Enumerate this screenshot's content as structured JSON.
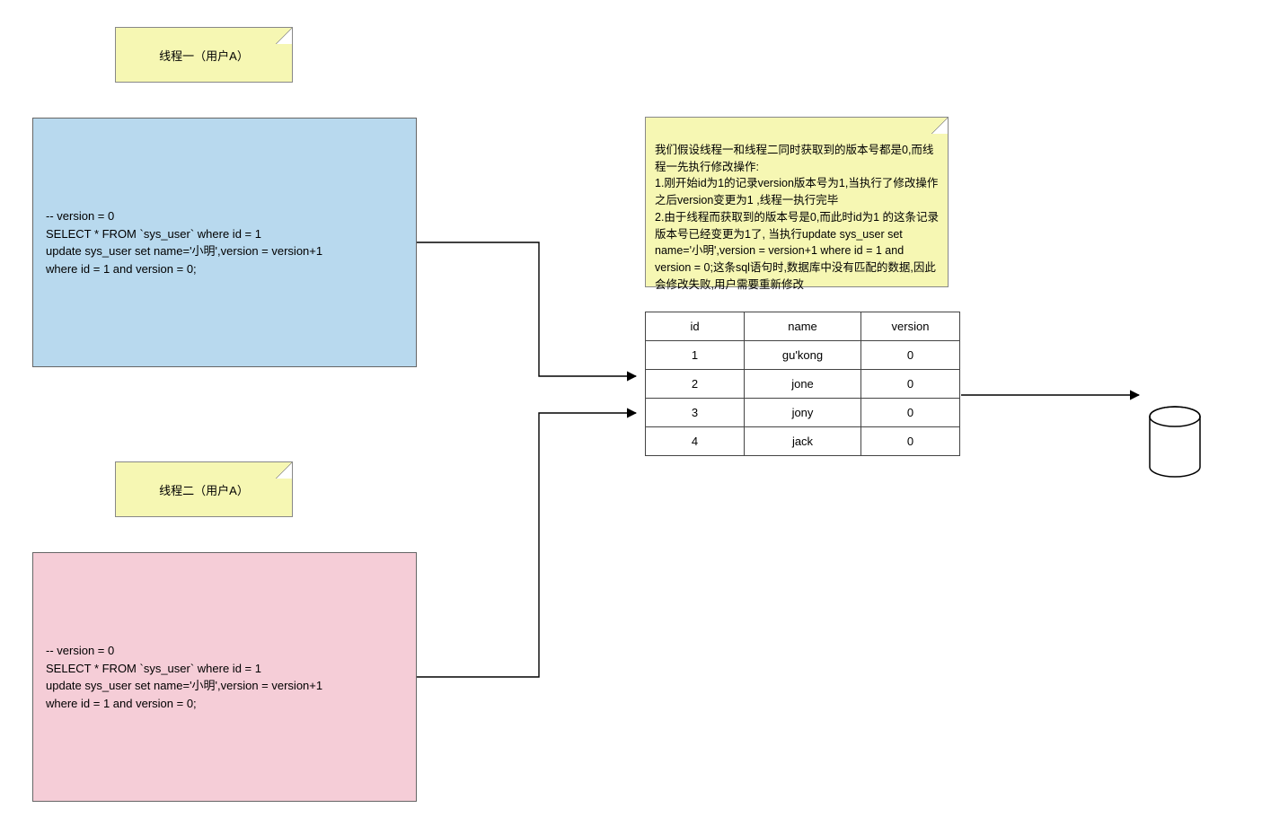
{
  "notes": {
    "thread1_label": "线程一（用户A）",
    "thread2_label": "线程二（用户A）",
    "explanation": "我们假设线程一和线程二同时获取到的版本号都是0,而线程一先执行修改操作:\n1.刚开始id为1的记录version版本号为1,当执行了修改操作之后version变更为1 ,线程一执行完毕\n2.由于线程而获取到的版本号是0,而此时id为1 的这条记录版本号已经变更为1了, 当执行update sys_user set name='小明',version = version+1   where id = 1 and version = 0;这条sql语句时,数据库中没有匹配的数据,因此会修改失败,用户需要重新修改"
  },
  "sql": {
    "thread1": "-- version = 0\nSELECT * FROM `sys_user` where id = 1\nupdate sys_user set name='小明',version = version+1\n where id = 1 and version = 0;",
    "thread2": "-- version = 0\nSELECT * FROM `sys_user` where id = 1\nupdate sys_user set name='小明',version = version+1\n where id = 1 and version = 0;"
  },
  "table": {
    "headers": {
      "id": "id",
      "name": "name",
      "version": "version"
    },
    "rows": [
      {
        "id": "1",
        "name": "gu'kong",
        "version": "0"
      },
      {
        "id": "2",
        "name": "jone",
        "version": "0"
      },
      {
        "id": "3",
        "name": "jony",
        "version": "0"
      },
      {
        "id": "4",
        "name": "jack",
        "version": "0"
      }
    ]
  }
}
